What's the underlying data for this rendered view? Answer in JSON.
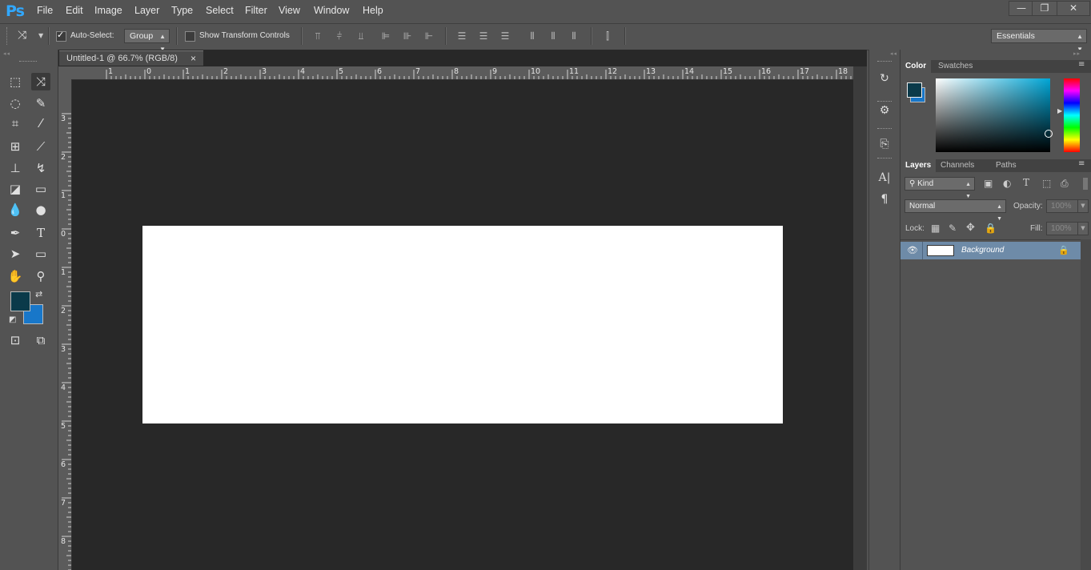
{
  "app": {
    "logo": "Ps"
  },
  "menu": [
    "File",
    "Edit",
    "Image",
    "Layer",
    "Type",
    "Select",
    "Filter",
    "View",
    "Window",
    "Help"
  ],
  "window_controls": {
    "minimize": "—",
    "restore": "❐",
    "close": "✕"
  },
  "options": {
    "auto_select_label": "Auto-Select:",
    "auto_select_checked": true,
    "group_value": "Group",
    "show_transform_label": "Show Transform Controls",
    "show_transform_checked": false,
    "workspace_value": "Essentials"
  },
  "document": {
    "tab_title": "Untitled-1 @ 66.7% (RGB/8)",
    "tab_close": "×",
    "ruler_h_labels": [
      "1",
      "0",
      "1",
      "2",
      "3",
      "4",
      "5",
      "6",
      "7",
      "8",
      "9",
      "10",
      "11",
      "12",
      "13",
      "14",
      "15",
      "16",
      "17",
      "18"
    ],
    "ruler_v_labels": [
      "3",
      "2",
      "1",
      "0",
      "1",
      "2",
      "3",
      "4",
      "5",
      "6",
      "7",
      "8"
    ]
  },
  "colors": {
    "foreground": "#0b3a4a",
    "background": "#1877c9",
    "panel_bg": "#535353",
    "canvas_bg": "#282828",
    "canvas": "#ffffff",
    "accent": "#31a8ff"
  },
  "color_panel": {
    "tabs": [
      "Color",
      "Swatches"
    ],
    "active_tab": "Color"
  },
  "layers_panel": {
    "tabs": [
      "Layers",
      "Channels",
      "Paths"
    ],
    "active_tab": "Layers",
    "filter_kind": "Kind",
    "blend_mode": "Normal",
    "opacity_label": "Opacity:",
    "opacity_value": "100%",
    "lock_label": "Lock:",
    "fill_label": "Fill:",
    "fill_value": "100%",
    "layers": [
      {
        "name": "Background",
        "visible": true,
        "locked": true
      }
    ]
  }
}
